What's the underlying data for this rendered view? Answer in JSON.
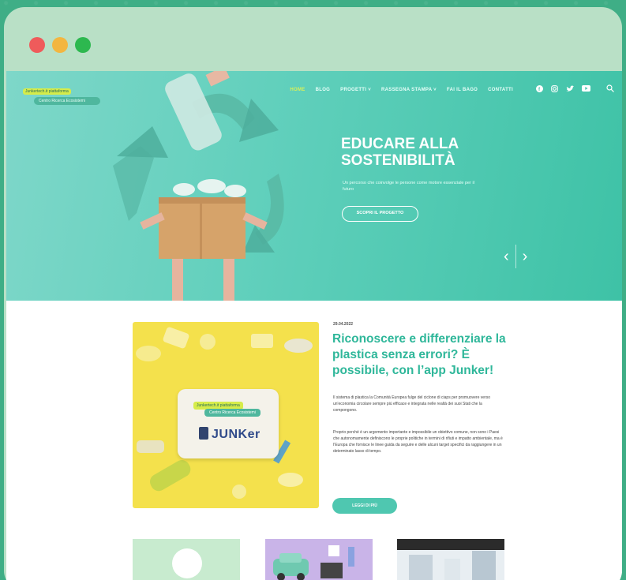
{
  "window": {
    "traffic_lights": [
      {
        "name": "close",
        "color": "#ef5b5b"
      },
      {
        "name": "minimize",
        "color": "#f3b640"
      },
      {
        "name": "maximize",
        "color": "#2db84f"
      }
    ]
  },
  "header": {
    "logo_line1": "Junkertech.it piattaforma",
    "logo_line2": "Centro Ricerca Ecosistemi",
    "nav": [
      {
        "label": "HOME",
        "active": true
      },
      {
        "label": "BLOG",
        "active": false
      },
      {
        "label": "PROGETTI ˅",
        "active": false
      },
      {
        "label": "RASSEGNA STAMPA ˅",
        "active": false
      },
      {
        "label": "FAI IL BAGO",
        "active": false
      },
      {
        "label": "CONTATTI",
        "active": false
      }
    ],
    "social_icons": [
      "facebook-icon",
      "instagram-icon",
      "twitter-icon",
      "youtube-icon"
    ],
    "search_icon": "search-icon"
  },
  "hero": {
    "title": "EDUCARE ALLA SOSTENIBILITÀ",
    "subtitle": "Un percorso che coinvolge le persone come motore essenziale per il futuro",
    "button": "SCOPRI IL PROGETTO",
    "prev": "‹",
    "next": "›",
    "colors": {
      "accent": "#d6f05a",
      "bg": "#5fcfbb"
    }
  },
  "article": {
    "date": "29.04.2022",
    "title": "Riconoscere e differenziare la plastica senza errori? È possibile, con l’app Junker!",
    "paragraph1": "Il sistema di plastica la Comunità Europea fulge del ciclone di ciaps per promuovere verso un'economia circolare sempre più efficace e integrata nelle realtà dei suoi Stati che la compongono.",
    "paragraph2": "Proprio perché è un argomento importante e impossibile un obiettivo comune, non sono i Paesi che autonomamente definiscono le proprie politiche in termini di rifiuti e impatto ambientale, ma è l’Europa che fornisce le linee guida da seguire e delle alcuni target specifici da raggiungere in un determinato lasso di tempo.",
    "button": "LEGGI DI PIÙ",
    "card_line1": "Junkertech.it piattaforma",
    "card_line2": "Centro Ricerca Ecosistemi",
    "brand": "JUNKer"
  }
}
